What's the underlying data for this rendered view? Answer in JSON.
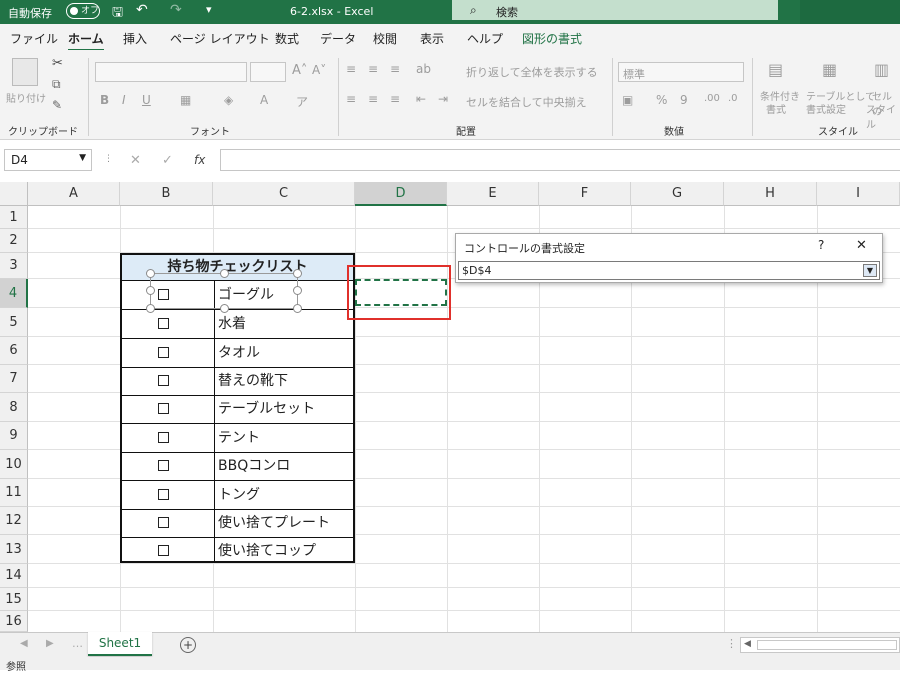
{
  "titlebar": {
    "autosave_label": "自動保存",
    "autosave_state": "オフ",
    "filename": "6-2.xlsx - Excel",
    "search_placeholder": "検索"
  },
  "tabs": [
    "ファイル",
    "ホーム",
    "挿入",
    "ページ レイアウト",
    "数式",
    "データ",
    "校閲",
    "表示",
    "ヘルプ",
    "図形の書式"
  ],
  "active_tab": "ホーム",
  "ribbon": {
    "clipboard": {
      "paste": "貼り付け",
      "group": "クリップボード"
    },
    "font": {
      "group": "フォント"
    },
    "alignment": {
      "wrap": "折り返して全体を表示する",
      "merge": "セルを結合して中央揃え",
      "group": "配置"
    },
    "number": {
      "format": "標準",
      "group": "数値"
    },
    "styles": {
      "cond1": "条件付き",
      "cond2": "書式",
      "table1": "テーブルとして",
      "table2": "書式設定",
      "cell1": "セルの",
      "cell2": "スタイル",
      "group": "スタイル"
    }
  },
  "formula_bar": {
    "name_box": "D4",
    "fx": "fx",
    "cancel": "✕",
    "enter": "✓",
    "formula": ""
  },
  "columns": [
    "A",
    "B",
    "C",
    "D",
    "E",
    "F",
    "G",
    "H",
    "I"
  ],
  "rows": [
    "1",
    "2",
    "3",
    "4",
    "5",
    "6",
    "7",
    "8",
    "9",
    "10",
    "11",
    "12",
    "13",
    "14",
    "15",
    "16"
  ],
  "checklist": {
    "title": "持ち物チェックリスト",
    "items": [
      "ゴーグル",
      "水着",
      "タオル",
      "替えの靴下",
      "テーブルセット",
      "テント",
      "BBQコンロ",
      "トング",
      "使い捨てプレート",
      "使い捨てコップ"
    ]
  },
  "dialog": {
    "title": "コントロールの書式設定",
    "help": "?",
    "close": "✕",
    "value": "$D$4"
  },
  "sheet_tabs": {
    "active": "Sheet1",
    "add": "+"
  },
  "status": "参照",
  "colors": {
    "excel_green": "#217346",
    "header_fill": "#ddebf7",
    "selection_red": "#e0302b",
    "marquee_green": "#217346"
  }
}
